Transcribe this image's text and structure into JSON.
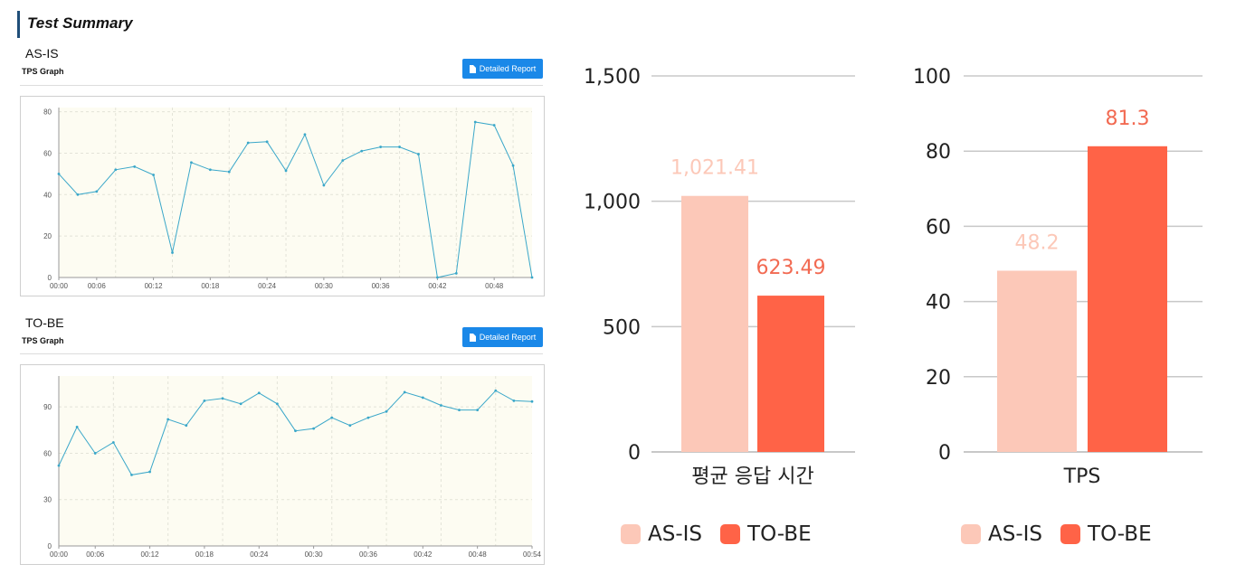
{
  "page": {
    "title": "Test Summary"
  },
  "asis_panel": {
    "section": "AS-IS",
    "graph_label": "TPS Graph",
    "report_button": "Detailed Report"
  },
  "tobe_panel": {
    "section": "TO-BE",
    "graph_label": "TPS Graph",
    "report_button": "Detailed Report"
  },
  "colors": {
    "line": "#3aa7c9",
    "plot_bg": "#fdfcf2",
    "asis_bar": "#fcc8b8",
    "tobe_bar": "#ff6347",
    "button": "#1a88e8"
  },
  "chart_data": [
    {
      "type": "line",
      "id": "asis-tps",
      "title": "",
      "x": [
        "00:00",
        "00:04",
        "00:06",
        "00:08",
        "00:10",
        "00:12",
        "00:14",
        "00:16",
        "00:18",
        "00:20",
        "00:22",
        "00:24",
        "00:26",
        "00:28",
        "00:30",
        "00:32",
        "00:34",
        "00:36",
        "00:38",
        "00:40",
        "00:42",
        "00:44",
        "00:46",
        "00:48",
        "00:50",
        "00:52"
      ],
      "values": [
        50,
        40,
        41.5,
        52,
        53.5,
        49.5,
        12,
        55.5,
        52,
        51,
        65,
        65.5,
        51.5,
        69,
        44.5,
        56.5,
        61,
        63,
        63,
        59.5,
        0,
        2,
        75,
        73.5,
        54,
        0
      ],
      "x_ticks": [
        "00:00",
        "00:06",
        "00:12",
        "00:18",
        "00:24",
        "00:30",
        "00:36",
        "00:42",
        "00:48"
      ],
      "y_ticks": [
        0,
        20,
        40,
        60,
        80
      ],
      "ylim": [
        0,
        82
      ],
      "grid": true
    },
    {
      "type": "line",
      "id": "tobe-tps",
      "title": "",
      "x": [
        "00:00",
        "00:04",
        "00:06",
        "00:08",
        "00:10",
        "00:12",
        "00:14",
        "00:16",
        "00:18",
        "00:20",
        "00:22",
        "00:24",
        "00:26",
        "00:28",
        "00:30",
        "00:32",
        "00:34",
        "00:36",
        "00:38",
        "00:40",
        "00:42",
        "00:44",
        "00:46",
        "00:48",
        "00:50",
        "00:52",
        "00:54"
      ],
      "values": [
        52,
        77,
        60,
        67,
        46,
        48,
        82,
        78,
        94,
        95.5,
        92,
        99,
        92,
        74.5,
        76,
        83,
        78,
        83,
        87,
        99.5,
        96,
        91,
        88,
        88,
        100.5,
        94,
        93.5
      ],
      "x_ticks": [
        "00:00",
        "00:06",
        "00:12",
        "00:18",
        "00:24",
        "00:30",
        "00:36",
        "00:42",
        "00:48",
        "00:54"
      ],
      "y_ticks": [
        0,
        30,
        60,
        90
      ],
      "ylim": [
        0,
        110
      ],
      "grid": true
    },
    {
      "type": "bar",
      "id": "avg-response",
      "categories": [
        "평균 응답 시간"
      ],
      "series": [
        {
          "name": "AS-IS",
          "values": [
            1021.41
          ],
          "label": "1,021.41"
        },
        {
          "name": "TO-BE",
          "values": [
            623.49
          ],
          "label": "623.49"
        }
      ],
      "y_ticks": [
        "0",
        "500",
        "1,000",
        "1,500"
      ],
      "y_values": [
        0,
        500,
        1000,
        1500
      ],
      "ylim": [
        0,
        1500
      ],
      "grid": true,
      "legend": "bottom"
    },
    {
      "type": "bar",
      "id": "tps-compare",
      "categories": [
        "TPS"
      ],
      "series": [
        {
          "name": "AS-IS",
          "values": [
            48.2
          ],
          "label": "48.2"
        },
        {
          "name": "TO-BE",
          "values": [
            81.3
          ],
          "label": "81.3"
        }
      ],
      "y_ticks": [
        "0",
        "20",
        "40",
        "60",
        "80",
        "100"
      ],
      "y_values": [
        0,
        20,
        40,
        60,
        80,
        100
      ],
      "ylim": [
        0,
        100
      ],
      "grid": true,
      "legend": "bottom"
    }
  ],
  "legend": {
    "asis": "AS-IS",
    "tobe": "TO-BE"
  }
}
